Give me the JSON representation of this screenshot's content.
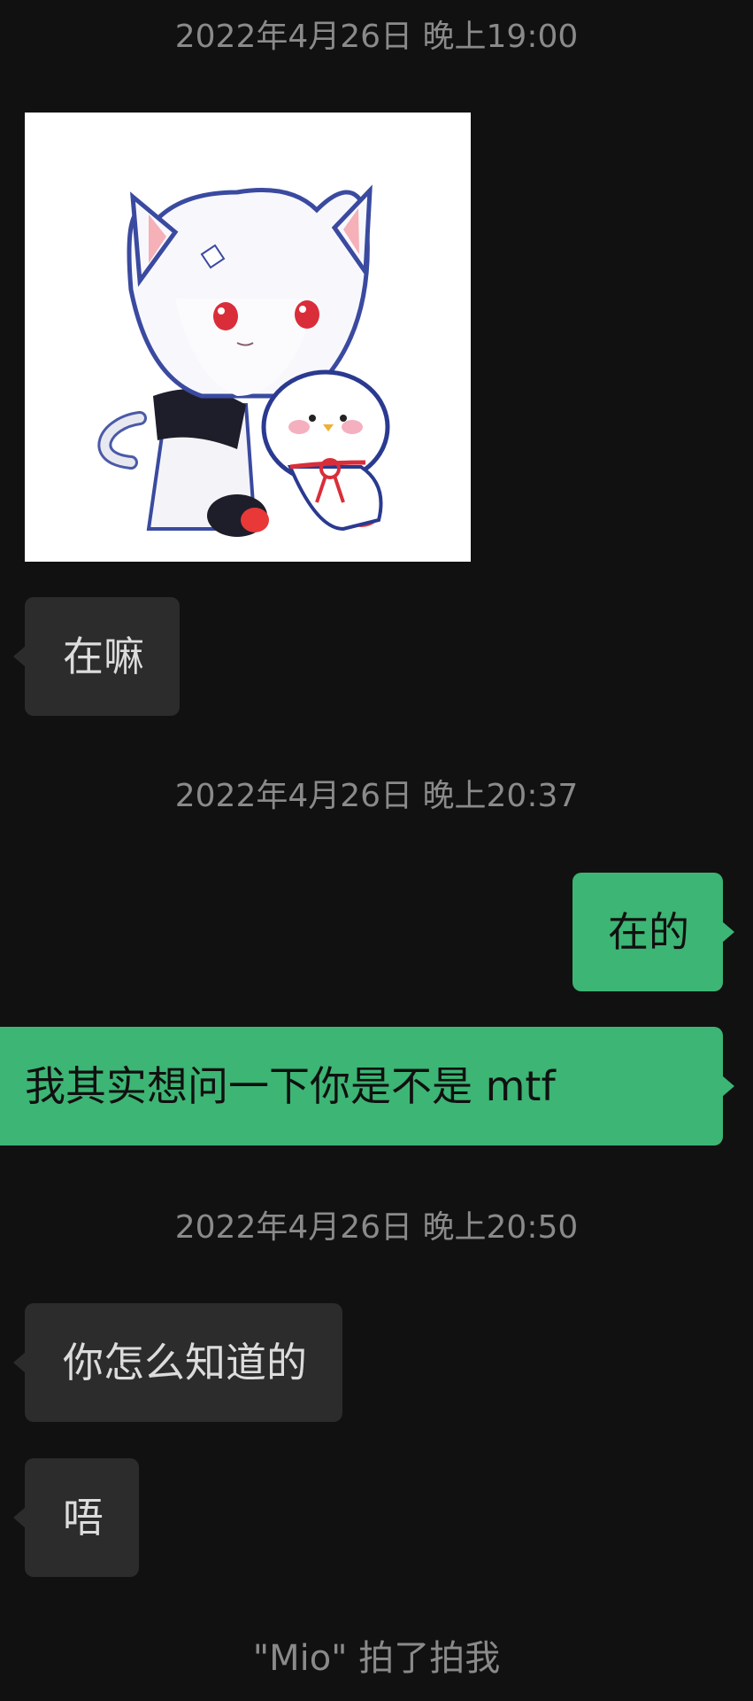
{
  "chat": {
    "timestamps": [
      "2022年4月26日 晚上19:00",
      "2022年4月26日 晚上20:37",
      "2022年4月26日 晚上20:50"
    ],
    "sticker": {
      "icon": "anime-cat-boy-sticker"
    },
    "messages": [
      {
        "direction": "incoming",
        "text": "在嘛"
      },
      {
        "direction": "outgoing",
        "text": "在的"
      },
      {
        "direction": "outgoing",
        "text": "我其实想问一下你是不是 mtf"
      },
      {
        "direction": "incoming",
        "text": "你怎么知道的"
      },
      {
        "direction": "incoming",
        "text": "唔"
      }
    ],
    "system_notice": "\"Mio\" 拍了拍我"
  },
  "colors": {
    "background": "#111111",
    "incoming_bubble": "#2c2c2c",
    "outgoing_bubble": "#3db574",
    "timestamp_text": "#8a8a8a"
  }
}
